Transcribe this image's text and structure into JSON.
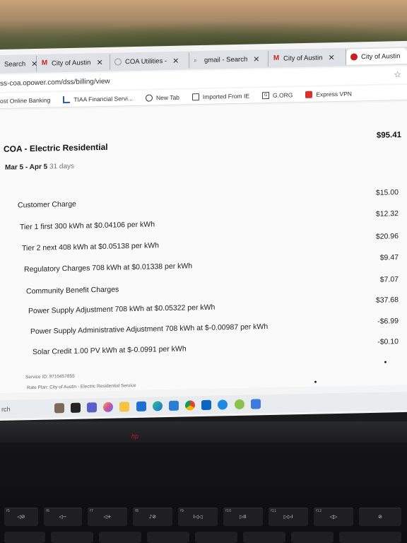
{
  "browser": {
    "tabs": [
      {
        "label": "Search",
        "icon": "search-icon",
        "close": "✕"
      },
      {
        "label": "City of Austin",
        "icon": "gmail-icon",
        "close": "✕"
      },
      {
        "label": "COA Utilities -",
        "icon": "coa-icon",
        "close": "✕"
      },
      {
        "label": "gmail - Search",
        "icon": "search-icon",
        "close": "✕"
      },
      {
        "label": "City of Austin",
        "icon": "gmail-icon",
        "close": "✕"
      },
      {
        "label": "City of Austin",
        "icon": "coa-red-icon",
        "close": ""
      }
    ],
    "url": "ss-coa.opower.com/dss/billing/view",
    "bookmarks": [
      {
        "label": "ost Online Banking",
        "icon": "bank-icon"
      },
      {
        "label": "TIAA Financial Servi...",
        "icon": "tiaa-icon"
      },
      {
        "label": "New Tab",
        "icon": "globe-icon"
      },
      {
        "label": "Imported From IE",
        "icon": "folder-icon"
      },
      {
        "label": "G.ORG",
        "icon": "gorg-icon"
      },
      {
        "label": "Express VPN",
        "icon": "vpn-icon"
      }
    ]
  },
  "bill": {
    "title": "COA - Electric Residential",
    "total": "$95.41",
    "period": "Mar 5 - Apr 5",
    "days": "31 days",
    "lines": [
      {
        "label": "Customer Charge",
        "amount": "$15.00"
      },
      {
        "label": "Tier 1 first 300 kWh at $0.04106 per kWh",
        "amount": "$12.32"
      },
      {
        "label": "Tier 2 next 408 kWh at $0.05138 per kWh",
        "amount": "$20.96"
      },
      {
        "label": "Regulatory Charges 708 kWh at $0.01338 per kWh",
        "amount": "$9.47"
      },
      {
        "label": "Community Benefit Charges",
        "amount": "$7.07"
      },
      {
        "label": "Power Supply Adjustment 708 kWh at $0.05322 per kWh",
        "amount": "$37.68"
      },
      {
        "label": "Power Supply Administrative Adjustment 708 kWh at $-0.00987 per kWh",
        "amount": "-$6.99"
      },
      {
        "label": "Solar Credit 1.00 PV kWh at $-0.0991 per kWh",
        "amount": "-$0.10"
      }
    ],
    "service_id": "Service ID: 9710457855",
    "rate_plan": "Rate Plan: City of Austin - Electric Residential Service"
  },
  "taskbar": {
    "search": "rch",
    "apps": [
      "widgets-icon",
      "file-explorer-icon",
      "teams-icon",
      "copilot-icon",
      "folder-icon",
      "store-icon",
      "edge-icon",
      "photos-icon",
      "chrome-icon",
      "outlook-icon",
      "chrome-canary-icon",
      "wps-icon",
      "settings-icon"
    ]
  },
  "keyboard": {
    "fkeys": [
      {
        "fn": "f5",
        "glyph": "◁⊘"
      },
      {
        "fn": "f6",
        "glyph": "◁−"
      },
      {
        "fn": "f7",
        "glyph": "◁+"
      },
      {
        "fn": "f8",
        "glyph": "♪⊘"
      },
      {
        "fn": "f9",
        "glyph": "I◁◁"
      },
      {
        "fn": "f10",
        "glyph": "▷II"
      },
      {
        "fn": "f11",
        "glyph": "▷▷I"
      },
      {
        "fn": "f12",
        "glyph": "◁▷"
      },
      {
        "fn": "",
        "glyph": "⊘"
      }
    ]
  }
}
